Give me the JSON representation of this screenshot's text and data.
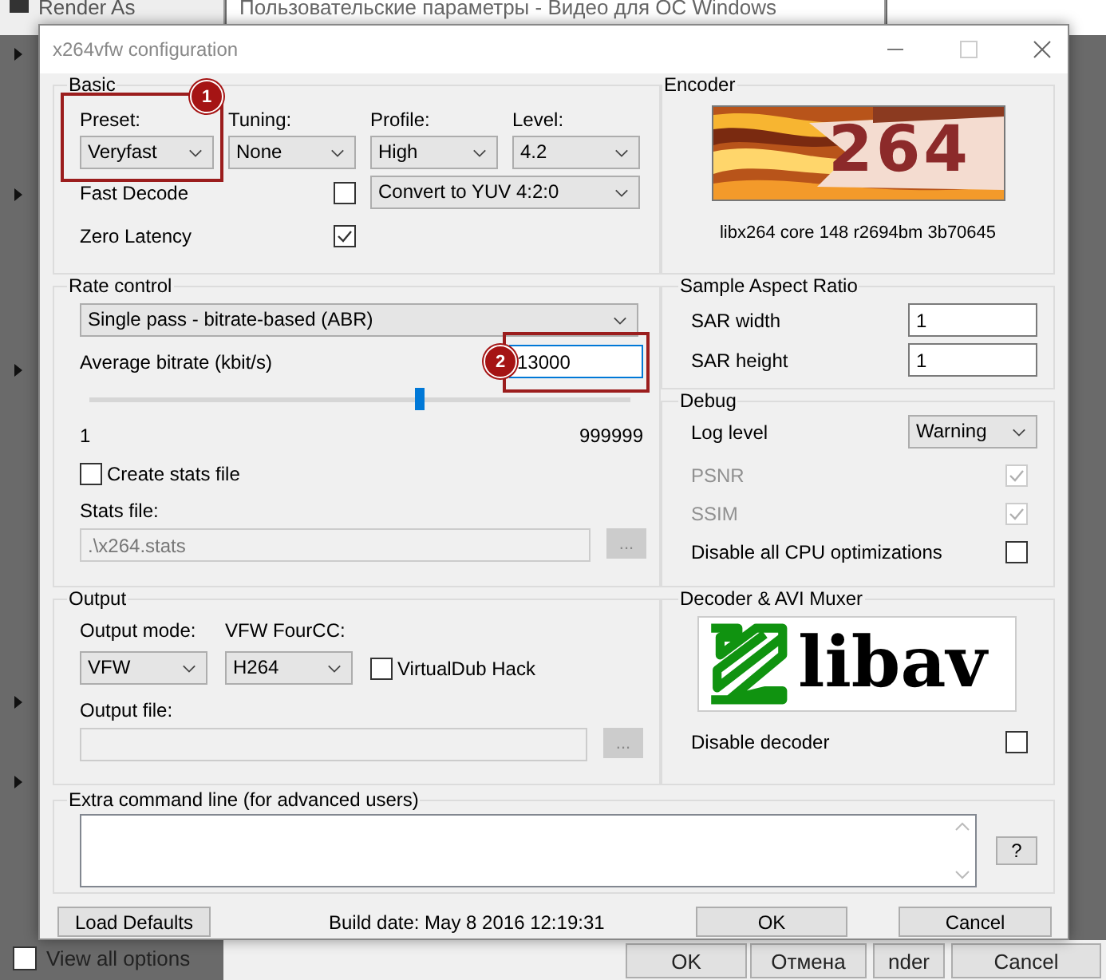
{
  "background": {
    "windows": [
      {
        "title": "Render As"
      },
      {
        "title": "Пользовательские параметры - Видео для ОС Windows"
      }
    ],
    "view_all_options": {
      "label": "View all options",
      "checked": false
    },
    "buttons": [
      "OK",
      "Отмена",
      "nder",
      "Cancel"
    ]
  },
  "window": {
    "title": "x264vfw configuration"
  },
  "basic": {
    "title": "Basic",
    "fields": [
      {
        "label": "Preset:",
        "value": "Veryfast",
        "callout": "1"
      },
      {
        "label": "Tuning:",
        "value": "None"
      },
      {
        "label": "Profile:",
        "value": "High"
      },
      {
        "label": "Level:",
        "value": "4.2"
      }
    ],
    "convert": "Convert to YUV 4:2:0",
    "options": [
      {
        "label": "Fast Decode",
        "checked": false
      },
      {
        "label": "Zero Latency",
        "checked": true
      }
    ]
  },
  "encoder": {
    "title": "Encoder",
    "logo_text": "264",
    "version": "libx264 core 148 r2694bm 3b70645"
  },
  "rate_control": {
    "title": "Rate control",
    "mode": "Single pass - bitrate-based (ABR)",
    "bitrate_label": "Average bitrate (kbit/s)",
    "bitrate_value": "13000",
    "callout": "2",
    "level": 0.61,
    "min": "1",
    "max": "999999",
    "create_stats": {
      "label": "Create stats file",
      "checked": false
    },
    "stats_label": "Stats file:",
    "stats_value": ".\\x264.stats",
    "browse": "..."
  },
  "sar": {
    "title": "Sample Aspect Ratio",
    "rows": [
      {
        "label": "SAR width",
        "value": "1"
      },
      {
        "label": "SAR height",
        "value": "1"
      }
    ]
  },
  "debug": {
    "title": "Debug",
    "log_label": "Log level",
    "log_value": "Warning",
    "options": [
      {
        "label": "PSNR",
        "checked": true,
        "disabled": true
      },
      {
        "label": "SSIM",
        "checked": true,
        "disabled": true
      },
      {
        "label": "Disable all CPU optimizations",
        "checked": false,
        "disabled": false
      }
    ]
  },
  "output": {
    "title": "Output",
    "mode_label": "Output mode:",
    "mode_value": "VFW",
    "fourcc_label": "VFW FourCC:",
    "fourcc_value": "H264",
    "vdub": {
      "label": "VirtualDub Hack",
      "checked": false
    },
    "file_label": "Output file:",
    "browse": "..."
  },
  "decoder": {
    "title": "Decoder & AVI Muxer",
    "logo_text": "libav",
    "disable": {
      "label": "Disable decoder",
      "checked": false
    }
  },
  "extra": {
    "title": "Extra command line (for advanced users)",
    "help": "?"
  },
  "footer": {
    "load_defaults": "Load Defaults",
    "build_date": "Build date: May  8 2016 12:19:31",
    "ok": "OK",
    "cancel": "Cancel"
  }
}
